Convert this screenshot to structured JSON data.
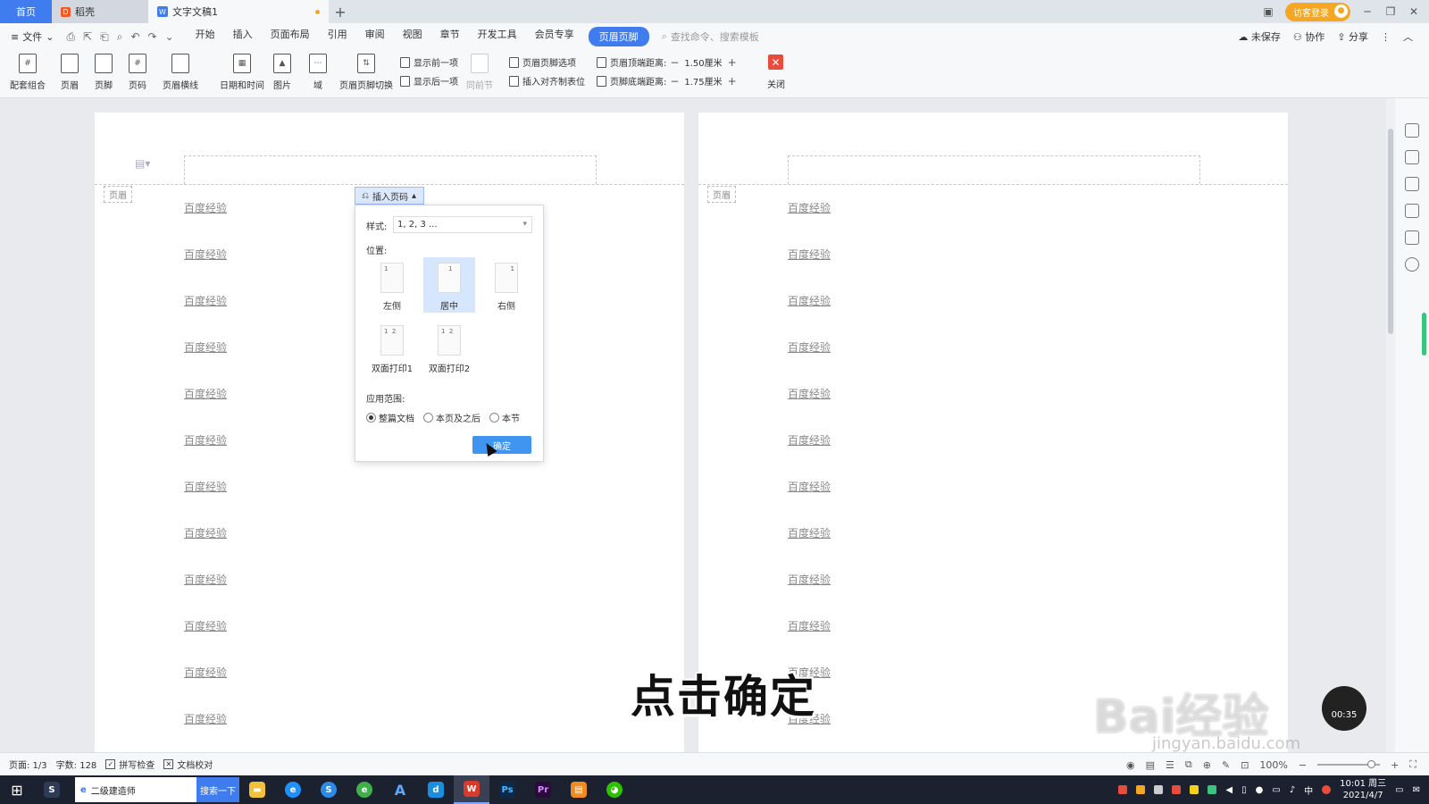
{
  "tabs": {
    "home": "首页",
    "daoke": "稻壳",
    "doc": "文字文稿1",
    "add": "+"
  },
  "topright": {
    "visitor_login": "访客登录",
    "win_min": "─",
    "win_max": "❐",
    "win_close": "✕"
  },
  "menu": {
    "file": "文件",
    "items": [
      "开始",
      "插入",
      "页面布局",
      "引用",
      "审阅",
      "视图",
      "章节",
      "开发工具",
      "会员专享"
    ],
    "active": "页眉页脚",
    "search_placeholder": "查找命令、搜索模板",
    "unsaved": "未保存",
    "collab": "协作",
    "share": "分享"
  },
  "ribbon": {
    "buttons": [
      "配套组合",
      "页眉",
      "页脚",
      "页码",
      "页眉横线",
      "日期和时间",
      "图片",
      "域",
      "页眉页脚切换",
      "同前节"
    ],
    "show_prev": "显示前一项",
    "show_next": "显示后一项",
    "hf_options": "页眉页脚选项",
    "insert_align_tab": "插入对齐制表位",
    "header_top_label": "页眉顶端距离:",
    "header_top_value": "1.50厘米",
    "footer_bottom_label": "页脚底端距离:",
    "footer_bottom_value": "1.75厘米",
    "close": "关闭"
  },
  "document": {
    "header_tag": "页眉",
    "line_text": "百度经验",
    "left_lines": [
      "百度经验",
      "百度经验",
      "百度经验",
      "百度经验",
      "百度经验",
      "百度经验",
      "百度经验",
      "百度经验",
      "百度经验",
      "百度经验",
      "百度经验",
      "百度经验"
    ],
    "right_lines": [
      "百度经验",
      "百度经验",
      "百度经验",
      "百度经验",
      "百度经验",
      "百度经验",
      "百度经验",
      "百度经验",
      "百度经验",
      "百度经验",
      "百度经验",
      "百度经验"
    ]
  },
  "dialog": {
    "button": "插入页码",
    "style_label": "样式:",
    "style_value": "1, 2, 3 ...",
    "position_label": "位置:",
    "positions": [
      "左侧",
      "居中",
      "右侧",
      "双面打印1",
      "双面打印2"
    ],
    "selected_position": "居中",
    "scope_label": "应用范围:",
    "scope_options": [
      "整篇文档",
      "本页及之后",
      "本节"
    ],
    "selected_scope": "整篇文档",
    "ok": "确定"
  },
  "status": {
    "page": "页面: 1/3",
    "words": "字数: 128",
    "spell": "拼写检查",
    "proof": "文档校对",
    "zoom": "100%"
  },
  "taskbar": {
    "search_text": "二级建造师",
    "search_button": "搜索一下",
    "time": "10:01 周三",
    "date": "2021/4/7",
    "ime": "中"
  },
  "overlay": {
    "subtitle": "点击确定",
    "watermark": "Bai经验",
    "watermark_url": "jingyan.baidu.com",
    "timer": "00:35"
  }
}
